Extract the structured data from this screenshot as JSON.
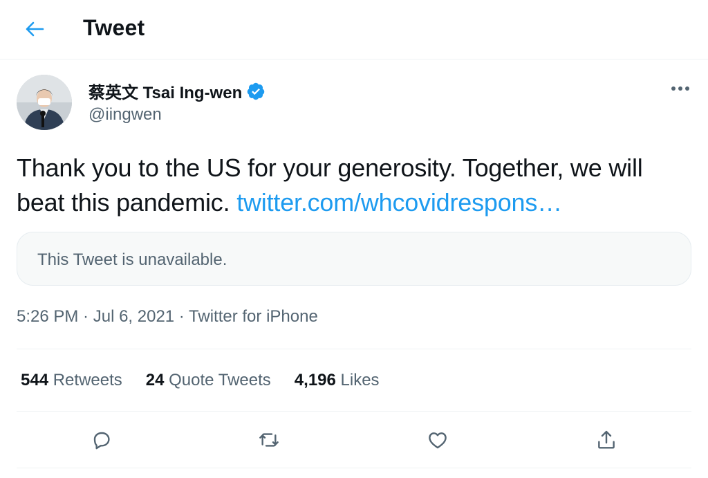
{
  "header": {
    "title": "Tweet",
    "back_icon": "arrow-left-icon",
    "accent": "#1d9bf0"
  },
  "author": {
    "name": "蔡英文 Tsai Ing-wen",
    "handle": "@iingwen",
    "verified": true,
    "avatar_icon": "profile-photo"
  },
  "tweet": {
    "text": "Thank you to the US for your generosity. Together, we will beat this pandemic.",
    "link_text": "twitter.com/whcovidrespons…",
    "link_color": "#1d9bf0"
  },
  "quote": {
    "text": "This Tweet is unavailable."
  },
  "meta": {
    "time": "5:26 PM",
    "date": "Jul 6, 2021",
    "source": "Twitter for iPhone",
    "separator": " · "
  },
  "stats": {
    "retweets": {
      "count": "544",
      "label": "Retweets"
    },
    "quote_tweets": {
      "count": "24",
      "label": "Quote Tweets"
    },
    "likes": {
      "count": "4,196",
      "label": "Likes"
    }
  },
  "actions": [
    {
      "name": "reply",
      "icon": "comment-icon"
    },
    {
      "name": "retweet",
      "icon": "retweet-icon"
    },
    {
      "name": "like",
      "icon": "heart-icon"
    },
    {
      "name": "share",
      "icon": "share-icon"
    }
  ],
  "colors": {
    "text": "#0f1419",
    "secondary": "#536471",
    "divider": "#eff3f4",
    "verified": "#1d9bf0"
  }
}
